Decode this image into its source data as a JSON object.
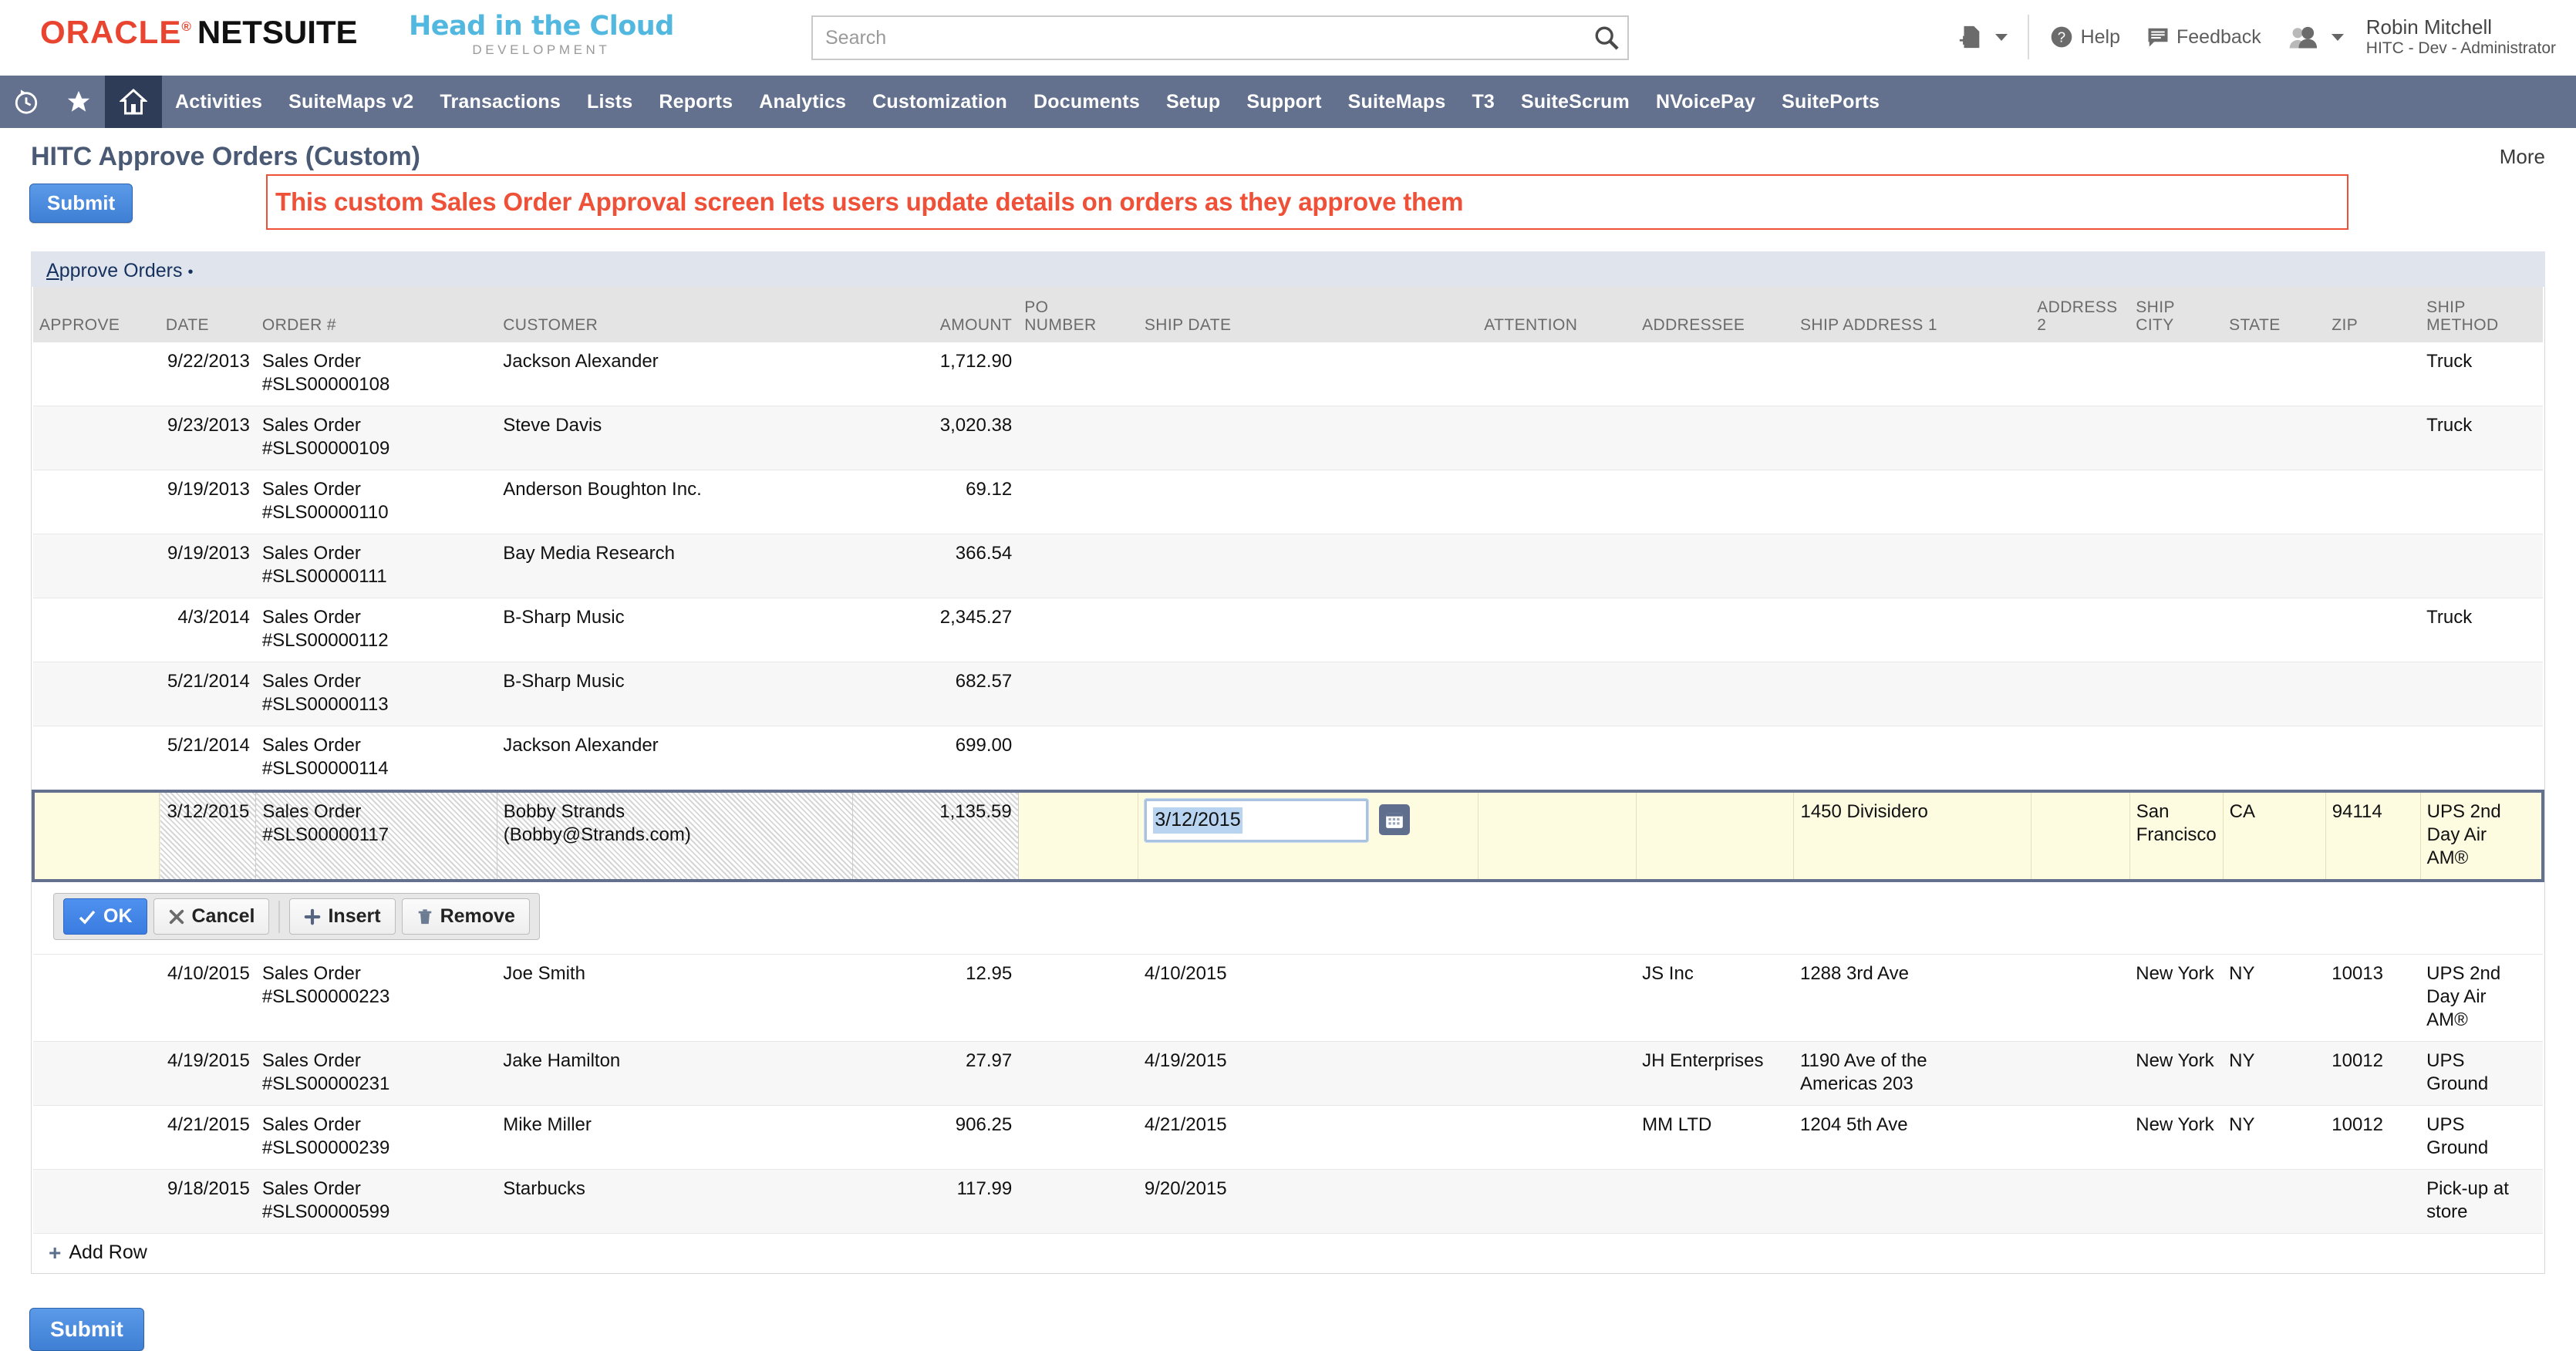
{
  "topbar": {
    "oracle_text": "ORACLE",
    "oracle_reg": "®",
    "netsuite_text_bold": "NET",
    "netsuite_text_light": "SUITE",
    "partner_logo_main": "Head in the Cloud",
    "partner_logo_sub": "DEVELOPMENT",
    "search_placeholder": "Search",
    "search_value": "",
    "help_label": "Help",
    "feedback_label": "Feedback",
    "user_name": "Robin Mitchell",
    "user_role": "HITC - Dev - Administrator"
  },
  "nav": {
    "items": [
      {
        "label": "Activities"
      },
      {
        "label": "SuiteMaps v2"
      },
      {
        "label": "Transactions"
      },
      {
        "label": "Lists"
      },
      {
        "label": "Reports"
      },
      {
        "label": "Analytics"
      },
      {
        "label": "Customization"
      },
      {
        "label": "Documents"
      },
      {
        "label": "Setup"
      },
      {
        "label": "Support"
      },
      {
        "label": "SuiteMaps"
      },
      {
        "label": "T3"
      },
      {
        "label": "SuiteScrum"
      },
      {
        "label": "NVoicePay"
      },
      {
        "label": "SuitePorts"
      }
    ]
  },
  "page": {
    "title": "HITC Approve Orders (Custom)",
    "more_label": "More",
    "submit_top_label": "Submit",
    "submit_bottom_label": "Submit",
    "banner_text": "This custom Sales Order Approval screen lets users update details on orders as they approve them",
    "banner_color": "#ef5138",
    "subtab_label_first": "A",
    "subtab_label_rest": "pprove Orders",
    "subtab_dot": "•",
    "add_row_label": "Add Row"
  },
  "grid": {
    "columns": [
      "APPROVE",
      "DATE",
      "ORDER #",
      "CUSTOMER",
      "AMOUNT",
      "PO NUMBER",
      "SHIP DATE",
      "ATTENTION",
      "ADDRESSEE",
      "SHIP ADDRESS 1",
      "ADDRESS 2",
      "SHIP CITY",
      "STATE",
      "ZIP",
      "SHIP METHOD"
    ],
    "column_headers_multiline": {
      "po_l1": "PO",
      "po_l2": "NUMBER",
      "addr2_l1": "ADDRESS",
      "addr2_l2": "2",
      "city_l1": "SHIP",
      "city_l2": "CITY",
      "method_l1": "SHIP",
      "method_l2": "METHOD"
    },
    "rows_before": [
      {
        "date": "9/22/2013",
        "order_l1": "Sales Order",
        "order_l2": "#SLS00000108",
        "customer": "Jackson Alexander",
        "customer_l2": "",
        "amount": "1,712.90",
        "po": "",
        "ship_date": "",
        "attention": "",
        "addressee": "",
        "address1": "",
        "address2": "",
        "city": "",
        "state": "",
        "zip": "",
        "method": "Truck"
      },
      {
        "date": "9/23/2013",
        "order_l1": "Sales Order",
        "order_l2": "#SLS00000109",
        "customer": "Steve Davis",
        "customer_l2": "",
        "amount": "3,020.38",
        "po": "",
        "ship_date": "",
        "attention": "",
        "addressee": "",
        "address1": "",
        "address2": "",
        "city": "",
        "state": "",
        "zip": "",
        "method": "Truck"
      },
      {
        "date": "9/19/2013",
        "order_l1": "Sales Order",
        "order_l2": "#SLS00000110",
        "customer": "Anderson Boughton Inc.",
        "customer_l2": "",
        "amount": "69.12",
        "po": "",
        "ship_date": "",
        "attention": "",
        "addressee": "",
        "address1": "",
        "address2": "",
        "city": "",
        "state": "",
        "zip": "",
        "method": ""
      },
      {
        "date": "9/19/2013",
        "order_l1": "Sales Order",
        "order_l2": "#SLS00000111",
        "customer": "Bay Media Research",
        "customer_l2": "",
        "amount": "366.54",
        "po": "",
        "ship_date": "",
        "attention": "",
        "addressee": "",
        "address1": "",
        "address2": "",
        "city": "",
        "state": "",
        "zip": "",
        "method": ""
      },
      {
        "date": "4/3/2014",
        "order_l1": "Sales Order",
        "order_l2": "#SLS00000112",
        "customer": "B-Sharp Music",
        "customer_l2": "",
        "amount": "2,345.27",
        "po": "",
        "ship_date": "",
        "attention": "",
        "addressee": "",
        "address1": "",
        "address2": "",
        "city": "",
        "state": "",
        "zip": "",
        "method": "Truck"
      },
      {
        "date": "5/21/2014",
        "order_l1": "Sales Order",
        "order_l2": "#SLS00000113",
        "customer": "B-Sharp Music",
        "customer_l2": "",
        "amount": "682.57",
        "po": "",
        "ship_date": "",
        "attention": "",
        "addressee": "",
        "address1": "",
        "address2": "",
        "city": "",
        "state": "",
        "zip": "",
        "method": ""
      },
      {
        "date": "5/21/2014",
        "order_l1": "Sales Order",
        "order_l2": "#SLS00000114",
        "customer": "Jackson Alexander",
        "customer_l2": "",
        "amount": "699.00",
        "po": "",
        "ship_date": "",
        "attention": "",
        "addressee": "",
        "address1": "",
        "address2": "",
        "city": "",
        "state": "",
        "zip": "",
        "method": ""
      }
    ],
    "editing_row": {
      "date": "3/12/2015",
      "order_l1": "Sales Order",
      "order_l2": "#SLS00000117",
      "customer": "Bobby Strands",
      "customer_l2": "(Bobby@Strands.com)",
      "amount": "1,135.59",
      "po": "",
      "ship_date_input_value": "3/12/2015",
      "attention": "",
      "addressee": "",
      "address1": "1450 Divisidero",
      "address2": "",
      "city_l1": "San",
      "city_l2": "Francisco",
      "state": "CA",
      "zip": "94114",
      "method_l1": "UPS 2nd",
      "method_l2": "Day Air",
      "method_l3": "AM®"
    },
    "edit_buttons": {
      "ok": "OK",
      "cancel": "Cancel",
      "insert": "Insert",
      "remove": "Remove"
    },
    "rows_after": [
      {
        "date": "4/10/2015",
        "order_l1": "Sales Order",
        "order_l2": "#SLS00000223",
        "customer": "Joe Smith",
        "customer_l2": "",
        "amount": "12.95",
        "po": "",
        "ship_date": "4/10/2015",
        "attention": "",
        "addressee": "JS Inc",
        "address1": "1288 3rd Ave",
        "address1_l2": "",
        "address2": "",
        "city": "New York",
        "state": "NY",
        "zip": "10013",
        "method_l1": "UPS 2nd",
        "method_l2": "Day Air",
        "method_l3": "AM®"
      },
      {
        "date": "4/19/2015",
        "order_l1": "Sales Order",
        "order_l2": "#SLS00000231",
        "customer": "Jake Hamilton",
        "customer_l2": "",
        "amount": "27.97",
        "po": "",
        "ship_date": "4/19/2015",
        "attention": "",
        "addressee": "JH Enterprises",
        "address1": "1190 Ave of the",
        "address1_l2": "Americas 203",
        "address2": "",
        "city": "New York",
        "state": "NY",
        "zip": "10012",
        "method_l1": "UPS",
        "method_l2": "Ground",
        "method_l3": ""
      },
      {
        "date": "4/21/2015",
        "order_l1": "Sales Order",
        "order_l2": "#SLS00000239",
        "customer": "Mike Miller",
        "customer_l2": "",
        "amount": "906.25",
        "po": "",
        "ship_date": "4/21/2015",
        "attention": "",
        "addressee": "MM LTD",
        "address1": "1204 5th Ave",
        "address1_l2": "",
        "address2": "",
        "city": "New York",
        "state": "NY",
        "zip": "10012",
        "method_l1": "UPS",
        "method_l2": "Ground",
        "method_l3": ""
      },
      {
        "date": "9/18/2015",
        "order_l1": "Sales Order",
        "order_l2": "#SLS00000599",
        "customer": "Starbucks",
        "customer_l2": "",
        "amount": "117.99",
        "po": "",
        "ship_date": "9/20/2015",
        "attention": "",
        "addressee": "",
        "address1": "",
        "address1_l2": "",
        "address2": "",
        "city": "",
        "state": "",
        "zip": "",
        "method_l1": "Pick-up at",
        "method_l2": "store",
        "method_l3": ""
      }
    ]
  },
  "colors": {
    "nav_bg": "#63718e",
    "nav_active": "#2f3c58",
    "brand_red": "#e8442f",
    "partner_blue": "#52b8e0",
    "edit_row_bg": "#fdfce0",
    "edit_border": "#63718e",
    "primary_button": "#3f7fd4"
  }
}
